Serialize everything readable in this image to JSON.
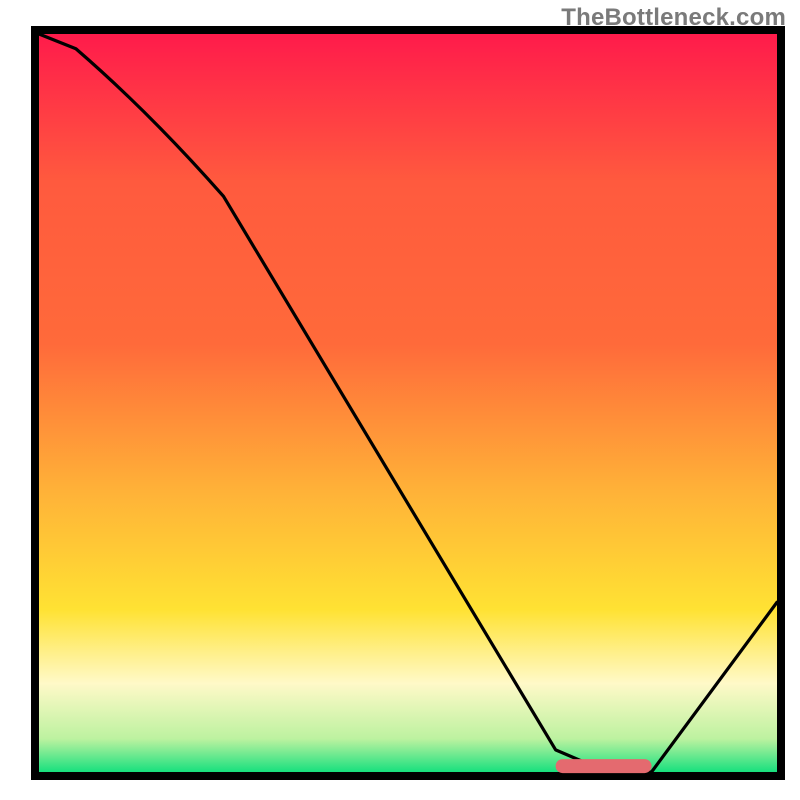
{
  "watermark": "TheBottleneck.com",
  "colors": {
    "bg_top": "#ff1b4b",
    "bg_mid1": "#ff6a3a",
    "bg_mid2": "#ffb238",
    "bg_mid3": "#ffe233",
    "bg_pale": "#fff9c8",
    "bg_green": "#18e07e",
    "axis": "#000000",
    "curve": "#000000",
    "marker": "#e46a6f"
  },
  "chart_data": {
    "type": "line",
    "title": "",
    "xlabel": "",
    "ylabel": "",
    "xlim": [
      0,
      100
    ],
    "ylim": [
      0,
      100
    ],
    "x": [
      0,
      5,
      25,
      70,
      77,
      83,
      100
    ],
    "values": [
      100,
      98,
      78,
      3,
      0,
      0,
      23
    ],
    "marker_segment": {
      "x_start": 70,
      "x_end": 83,
      "y": 0.8
    },
    "notes": "Black curve descends from top-left, bends near x≈25, reaches valley floor around x≈70–83, then rises toward the right edge. A short rounded red/pink segment sits on the valley floor. Background is a vertical heat gradient (red→orange→yellow→pale→green) inside a black-bordered square; watermark text sits at top-right outside the plot interior."
  }
}
